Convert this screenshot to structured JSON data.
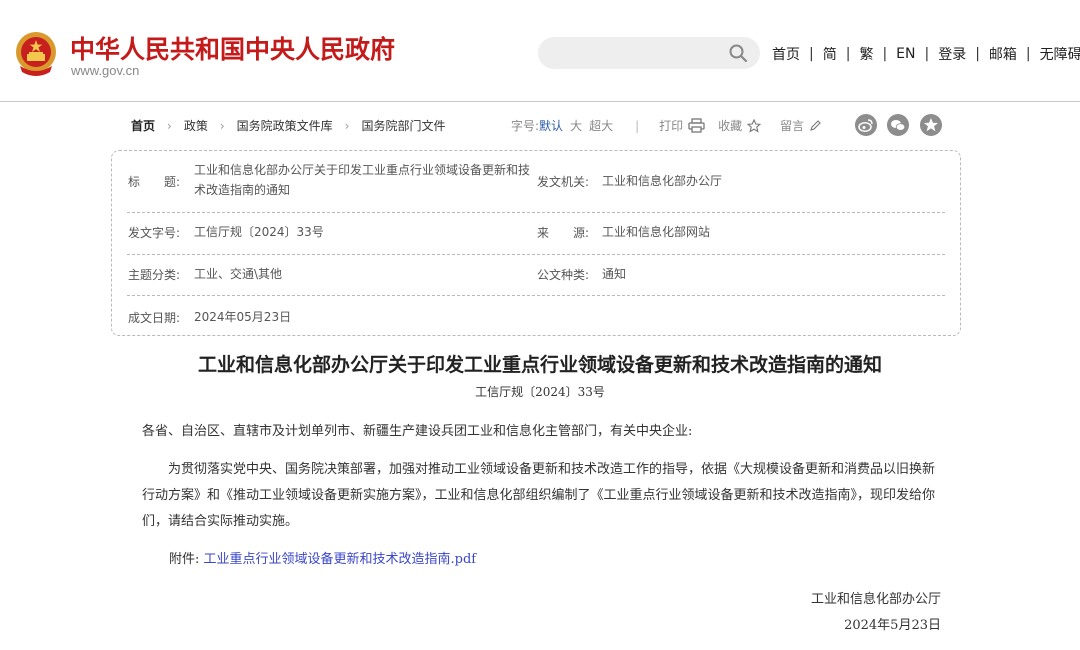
{
  "header": {
    "site_title": "中华人民共和国中央人民政府",
    "site_url": "www.gov.cn",
    "search": {
      "value": "",
      "placeholder": ""
    },
    "nav": [
      "首页",
      "简",
      "繁",
      "EN",
      "登录",
      "邮箱",
      "无障碍"
    ],
    "nav_separator": "|",
    "brand_color": "#c41a1a"
  },
  "breadcrumb": [
    "首页",
    "政策",
    "国务院政策文件库",
    "国务院部门文件"
  ],
  "tools": {
    "font_size_label": "字号:",
    "font_sizes": [
      "默认",
      "大",
      "超大"
    ],
    "active_font_size": "默认",
    "print_label": "打印",
    "favorite_label": "收藏",
    "comment_label": "留言",
    "share_icons": [
      "weibo-icon",
      "wechat-icon",
      "qzone-icon"
    ]
  },
  "info": {
    "title_label": "标　　题:",
    "title_value": "工业和信息化部办公厅关于印发工业重点行业领域设备更新和技术改造指南的通知",
    "issuer_label": "发文机关:",
    "issuer_value": "工业和信息化部办公厅",
    "doc_no_label": "发文字号:",
    "doc_no_value": "工信厅规〔2024〕33号",
    "source_label": "来　　源:",
    "source_value": "工业和信息化部网站",
    "topic_label": "主题分类:",
    "topic_value": "工业、交通\\其他",
    "type_label": "公文种类:",
    "type_value": "通知",
    "date_label": "成文日期:",
    "date_value": "2024年05月23日"
  },
  "article": {
    "title": "工业和信息化部办公厅关于印发工业重点行业领域设备更新和技术改造指南的通知",
    "doc_no": "工信厅规〔2024〕33号",
    "addressee": "各省、自治区、直辖市及计划单列市、新疆生产建设兵团工业和信息化主管部门，有关中央企业:",
    "body": "为贯彻落实党中央、国务院决策部署，加强对推动工业领域设备更新和技术改造工作的指导，依据《大规模设备更新和消费品以旧换新行动方案》和《推动工业领域设备更新实施方案》，工业和信息化部组织编制了《工业重点行业领域设备更新和技术改造指南》，现印发给你们，请结合实际推动实施。",
    "attachment_label": "附件:",
    "attachment_link": "工业重点行业领域设备更新和技术改造指南.pdf",
    "signer": "工业和信息化部办公厅",
    "sign_date": "2024年5月23日",
    "link_color": "#3a46c8"
  }
}
